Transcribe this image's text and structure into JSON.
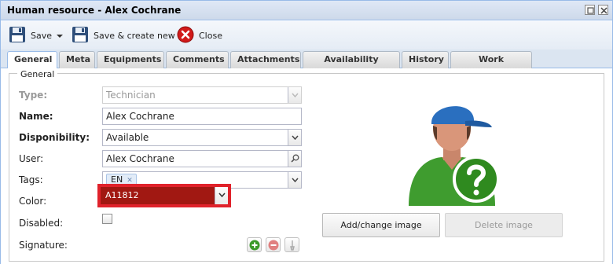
{
  "window": {
    "title": "Human resource - Alex Cochrane"
  },
  "icons": {
    "restore": "restore-icon",
    "close": "close-icon",
    "save": "floppy-disk-icon",
    "save_create": "floppy-disk-icon",
    "cancel": "red-x-circle-icon",
    "dropdown": "chevron-down-icon",
    "search": "magnifier-icon",
    "add": "green-plus-icon",
    "remove": "red-minus-icon",
    "sign": "pen-icon",
    "avatar": "user-question-icon"
  },
  "toolbar": {
    "save_label": "Save",
    "save_create_label": "Save & create new",
    "close_label": "Close"
  },
  "tabs": [
    {
      "label": "General",
      "active": true
    },
    {
      "label": "Meta"
    },
    {
      "label": "Equipments"
    },
    {
      "label": "Comments"
    },
    {
      "label": "Attachments"
    },
    {
      "label": "Availability history"
    },
    {
      "label": "History"
    },
    {
      "label": "Work schedule"
    }
  ],
  "form": {
    "legend": "General",
    "type": {
      "label": "Type:",
      "value": "Technician"
    },
    "name": {
      "label": "Name:",
      "value": "Alex Cochrane"
    },
    "disponibility": {
      "label": "Disponibility:",
      "value": "Available"
    },
    "user": {
      "label": "User:",
      "value": "Alex Cochrane"
    },
    "tags": {
      "label": "Tags:",
      "chips": [
        "EN"
      ]
    },
    "color": {
      "label": "Color:",
      "value": "A11812",
      "swatch": "#a11812",
      "highlight": "#e0222b"
    },
    "disabled": {
      "label": "Disabled:",
      "checked": false
    },
    "signature": {
      "label": "Signature:"
    }
  },
  "image": {
    "add_label": "Add/change image",
    "delete_label": "Delete image"
  }
}
